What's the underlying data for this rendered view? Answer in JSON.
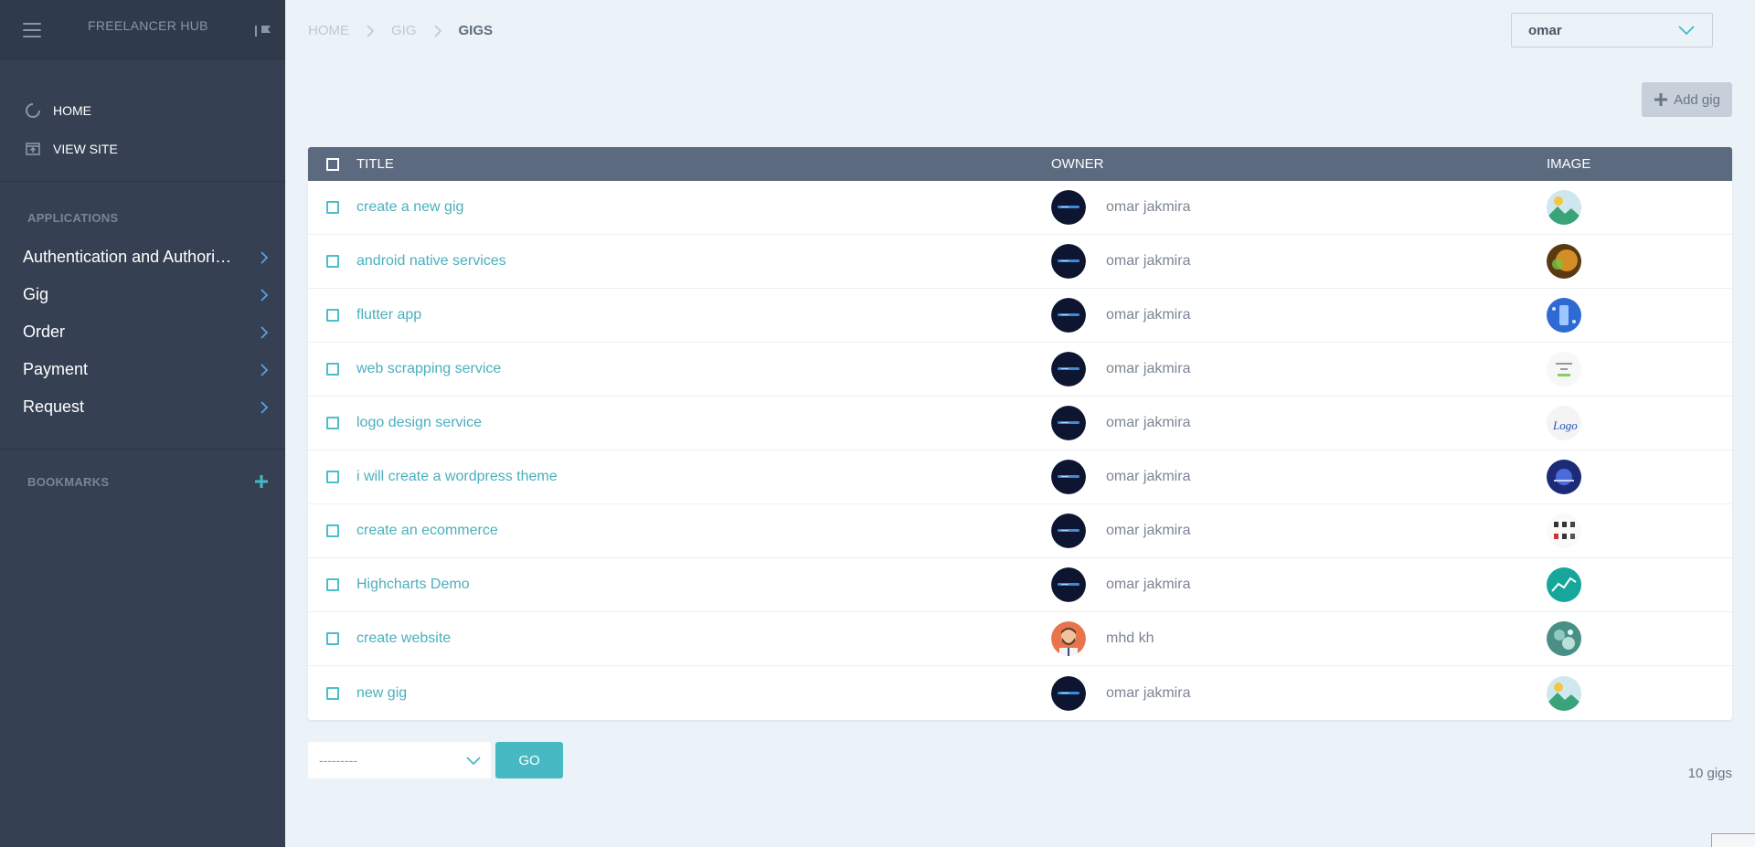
{
  "sidebar": {
    "brand": "FREELANCER HUB",
    "links": [
      {
        "label": "HOME",
        "icon": "circle-notch-icon"
      },
      {
        "label": "VIEW SITE",
        "icon": "view-site-icon"
      }
    ],
    "applications_title": "APPLICATIONS",
    "apps": [
      {
        "label": "Authentication and Authoriz…"
      },
      {
        "label": "Gig"
      },
      {
        "label": "Order"
      },
      {
        "label": "Payment"
      },
      {
        "label": "Request"
      }
    ],
    "bookmarks_title": "BOOKMARKS"
  },
  "breadcrumb": [
    "HOME",
    "GIG",
    "GIGS"
  ],
  "user_select": {
    "value": "omar"
  },
  "add_button": {
    "label": "Add gig"
  },
  "table": {
    "headers": {
      "title": "TITLE",
      "owner": "OWNER",
      "image": "IMAGE"
    },
    "rows": [
      {
        "title": "create a new gig",
        "owner": "omar jakmira",
        "avatar": "dark",
        "thumb": "landscape"
      },
      {
        "title": "android native services",
        "owner": "omar jakmira",
        "avatar": "dark",
        "thumb": "orange-glow"
      },
      {
        "title": "flutter app",
        "owner": "omar jakmira",
        "avatar": "dark",
        "thumb": "blue-phone"
      },
      {
        "title": "web scrapping service",
        "owner": "omar jakmira",
        "avatar": "dark",
        "thumb": "white-text"
      },
      {
        "title": "logo design service",
        "owner": "omar jakmira",
        "avatar": "dark",
        "thumb": "logo-text"
      },
      {
        "title": "i will create a wordpress theme",
        "owner": "omar jakmira",
        "avatar": "dark",
        "thumb": "navy-globe"
      },
      {
        "title": "create an ecommerce",
        "owner": "omar jakmira",
        "avatar": "dark",
        "thumb": "products"
      },
      {
        "title": "Highcharts Demo",
        "owner": "omar jakmira",
        "avatar": "dark",
        "thumb": "teal-chart"
      },
      {
        "title": "create website",
        "owner": "mhd kh",
        "avatar": "person",
        "thumb": "teal-circles"
      },
      {
        "title": "new gig",
        "owner": "omar jakmira",
        "avatar": "dark",
        "thumb": "landscape"
      }
    ]
  },
  "action_select": {
    "value": "---------"
  },
  "go_button": {
    "label": "GO"
  },
  "result_count": "10 gigs",
  "colors": {
    "sidebar": "#354152",
    "accent": "#47b9c2",
    "header": "#5c6a7f",
    "link": "#4bafbd"
  }
}
